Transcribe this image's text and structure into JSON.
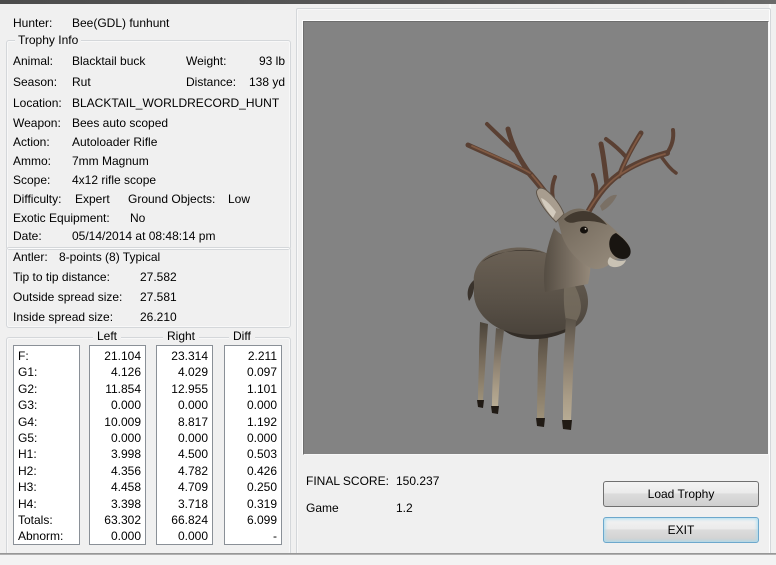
{
  "hunter": {
    "label": "Hunter:",
    "name": "Bee(GDL) funhunt"
  },
  "trophy_info": {
    "title": "Trophy Info",
    "animal_label": "Animal:",
    "animal": "Blacktail buck",
    "weight_label": "Weight:",
    "weight": "93 lb",
    "season_label": "Season:",
    "season": "Rut",
    "distance_label": "Distance:",
    "distance": "138 yd",
    "location_label": "Location:",
    "location": "BLACKTAIL_WORLDRECORD_HUNT",
    "weapon_label": "Weapon:",
    "weapon": "Bees auto scoped",
    "action_label": "Action:",
    "action": "Autoloader Rifle",
    "ammo_label": "Ammo:",
    "ammo": "7mm Magnum",
    "scope_label": "Scope:",
    "scope": "4x12 rifle scope",
    "difficulty_label": "Difficulty:",
    "difficulty": "Expert",
    "ground_objects_label": "Ground Objects:",
    "ground_objects": "Low",
    "exotic_label": "Exotic Equipment:",
    "exotic": "No",
    "date_label": "Date:",
    "date": "05/14/2014 at 08:48:14 pm"
  },
  "antler_info": {
    "antler_label": "Antler:",
    "antler_value": "8-points (8) Typical",
    "tip_label": "Tip to tip distance:",
    "tip_value": "27.582",
    "outside_label": "Outside spread size:",
    "outside_value": "27.581",
    "inside_label": "Inside spread size:",
    "inside_value": "26.210"
  },
  "measurements": {
    "columns": [
      "Left",
      "Right",
      "Diff"
    ],
    "rows": [
      {
        "label": "F:",
        "left": "21.104",
        "right": "23.314",
        "diff": "2.211"
      },
      {
        "label": "G1:",
        "left": "4.126",
        "right": "4.029",
        "diff": "0.097"
      },
      {
        "label": "G2:",
        "left": "11.854",
        "right": "12.955",
        "diff": "1.101"
      },
      {
        "label": "G3:",
        "left": "0.000",
        "right": "0.000",
        "diff": "0.000"
      },
      {
        "label": "G4:",
        "left": "10.009",
        "right": "8.817",
        "diff": "1.192"
      },
      {
        "label": "G5:",
        "left": "0.000",
        "right": "0.000",
        "diff": "0.000"
      },
      {
        "label": "H1:",
        "left": "3.998",
        "right": "4.500",
        "diff": "0.503"
      },
      {
        "label": "H2:",
        "left": "4.356",
        "right": "4.782",
        "diff": "0.426"
      },
      {
        "label": "H3:",
        "left": "4.458",
        "right": "4.709",
        "diff": "0.250"
      },
      {
        "label": "H4:",
        "left": "3.398",
        "right": "3.718",
        "diff": "0.319"
      },
      {
        "label": "Totals:",
        "left": "63.302",
        "right": "66.824",
        "diff": "6.099"
      },
      {
        "label": "Abnorm:",
        "left": "0.000",
        "right": "0.000",
        "diff": "-"
      }
    ]
  },
  "score": {
    "final_label": "FINAL SCORE:",
    "final_value": "150.237",
    "game_label": "Game",
    "game_value": "1.2"
  },
  "buttons": {
    "load_trophy": "Load Trophy",
    "exit": "EXIT"
  },
  "preview": {
    "bg": "#838383",
    "icon": "deer-3d-render",
    "colors": {
      "body": "#5a5248",
      "antler": "#5a4033",
      "leg_lower": "#ab9e88",
      "nose": "#191511"
    }
  }
}
